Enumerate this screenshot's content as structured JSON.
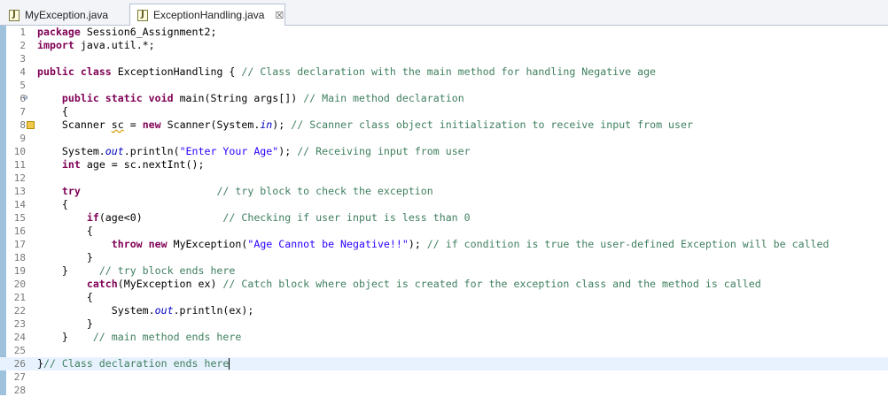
{
  "tabs": [
    {
      "label": "MyException.java",
      "active": false,
      "icon": "java-file-icon"
    },
    {
      "label": "ExceptionHandling.java",
      "active": true,
      "icon": "java-file-icon",
      "close": "☒"
    }
  ],
  "colors": {
    "keyword": "#7f0055",
    "comment": "#3f7f5f",
    "string": "#2a00ff",
    "static_field": "#0000c0",
    "current_line": "#e8f2fe",
    "line_number": "#787878"
  },
  "editor": {
    "current_line": 26,
    "lines": [
      {
        "n": "1",
        "tokens": [
          {
            "t": "package",
            "c": "kw"
          },
          {
            "t": " Session6_Assignment2;"
          }
        ]
      },
      {
        "n": "2",
        "tokens": [
          {
            "t": "import",
            "c": "kw"
          },
          {
            "t": " java.util.*;"
          }
        ]
      },
      {
        "n": "3",
        "tokens": []
      },
      {
        "n": "4",
        "tokens": [
          {
            "t": "public",
            "c": "kw"
          },
          {
            "t": " "
          },
          {
            "t": "class",
            "c": "kw"
          },
          {
            "t": " ExceptionHandling { "
          },
          {
            "t": "// Class declaration with the main method for handling Negative age",
            "c": "cm"
          }
        ]
      },
      {
        "n": "5",
        "tokens": []
      },
      {
        "n": "6",
        "marker": "⊖",
        "tokens": [
          {
            "t": "    "
          },
          {
            "t": "public",
            "c": "kw"
          },
          {
            "t": " "
          },
          {
            "t": "static",
            "c": "kw"
          },
          {
            "t": " "
          },
          {
            "t": "void",
            "c": "kw"
          },
          {
            "t": " main(String args[]) "
          },
          {
            "t": "// Main method declaration",
            "c": "cm"
          }
        ]
      },
      {
        "n": "7",
        "tokens": [
          {
            "t": "    {"
          }
        ]
      },
      {
        "n": "8",
        "warning": true,
        "tokens": [
          {
            "t": "    Scanner "
          },
          {
            "t": "sc",
            "c": "warnul"
          },
          {
            "t": " = "
          },
          {
            "t": "new",
            "c": "kw"
          },
          {
            "t": " Scanner(System."
          },
          {
            "t": "in",
            "c": "fld"
          },
          {
            "t": "); "
          },
          {
            "t": "// Scanner class object initialization to receive input from user",
            "c": "cm"
          }
        ]
      },
      {
        "n": "9",
        "tokens": []
      },
      {
        "n": "10",
        "tokens": [
          {
            "t": "    System."
          },
          {
            "t": "out",
            "c": "fld"
          },
          {
            "t": ".println("
          },
          {
            "t": "\"Enter Your Age\"",
            "c": "str"
          },
          {
            "t": "); "
          },
          {
            "t": "// Receiving input from user",
            "c": "cm"
          }
        ]
      },
      {
        "n": "11",
        "tokens": [
          {
            "t": "    "
          },
          {
            "t": "int",
            "c": "kw"
          },
          {
            "t": " age = sc.nextInt();"
          }
        ]
      },
      {
        "n": "12",
        "tokens": []
      },
      {
        "n": "13",
        "tokens": [
          {
            "t": "    "
          },
          {
            "t": "try",
            "c": "kw"
          },
          {
            "t": "                      "
          },
          {
            "t": "// try block to check the exception",
            "c": "cm"
          }
        ]
      },
      {
        "n": "14",
        "tokens": [
          {
            "t": "    {"
          }
        ]
      },
      {
        "n": "15",
        "tokens": [
          {
            "t": "        "
          },
          {
            "t": "if",
            "c": "kw"
          },
          {
            "t": "(age<0)             "
          },
          {
            "t": "// Checking if user input is less than 0",
            "c": "cm"
          }
        ]
      },
      {
        "n": "16",
        "tokens": [
          {
            "t": "        {"
          }
        ]
      },
      {
        "n": "17",
        "tokens": [
          {
            "t": "            "
          },
          {
            "t": "throw",
            "c": "kw"
          },
          {
            "t": " "
          },
          {
            "t": "new",
            "c": "kw"
          },
          {
            "t": " MyException("
          },
          {
            "t": "\"Age Cannot be Negative!!\"",
            "c": "str"
          },
          {
            "t": "); "
          },
          {
            "t": "// if condition is true the user-defined Exception will be called",
            "c": "cm"
          }
        ]
      },
      {
        "n": "18",
        "tokens": [
          {
            "t": "        }"
          }
        ]
      },
      {
        "n": "19",
        "tokens": [
          {
            "t": "    }     "
          },
          {
            "t": "// try block ends here",
            "c": "cm"
          }
        ]
      },
      {
        "n": "20",
        "tokens": [
          {
            "t": "        "
          },
          {
            "t": "catch",
            "c": "kw"
          },
          {
            "t": "(MyException ex) "
          },
          {
            "t": "// Catch block where object is created for the exception class and the method is called",
            "c": "cm"
          }
        ]
      },
      {
        "n": "21",
        "tokens": [
          {
            "t": "        {"
          }
        ]
      },
      {
        "n": "22",
        "tokens": [
          {
            "t": "            System."
          },
          {
            "t": "out",
            "c": "fld"
          },
          {
            "t": ".println(ex);"
          }
        ]
      },
      {
        "n": "23",
        "tokens": [
          {
            "t": "        }"
          }
        ]
      },
      {
        "n": "24",
        "tokens": [
          {
            "t": "    }    "
          },
          {
            "t": "// main method ends here",
            "c": "cm"
          }
        ]
      },
      {
        "n": "25",
        "tokens": []
      },
      {
        "n": "26",
        "caret": true,
        "tokens": [
          {
            "t": "}"
          },
          {
            "t": "// Class declaration ends here",
            "c": "cm"
          }
        ]
      },
      {
        "n": "27",
        "tokens": []
      },
      {
        "n": "28",
        "tokens": []
      }
    ]
  }
}
